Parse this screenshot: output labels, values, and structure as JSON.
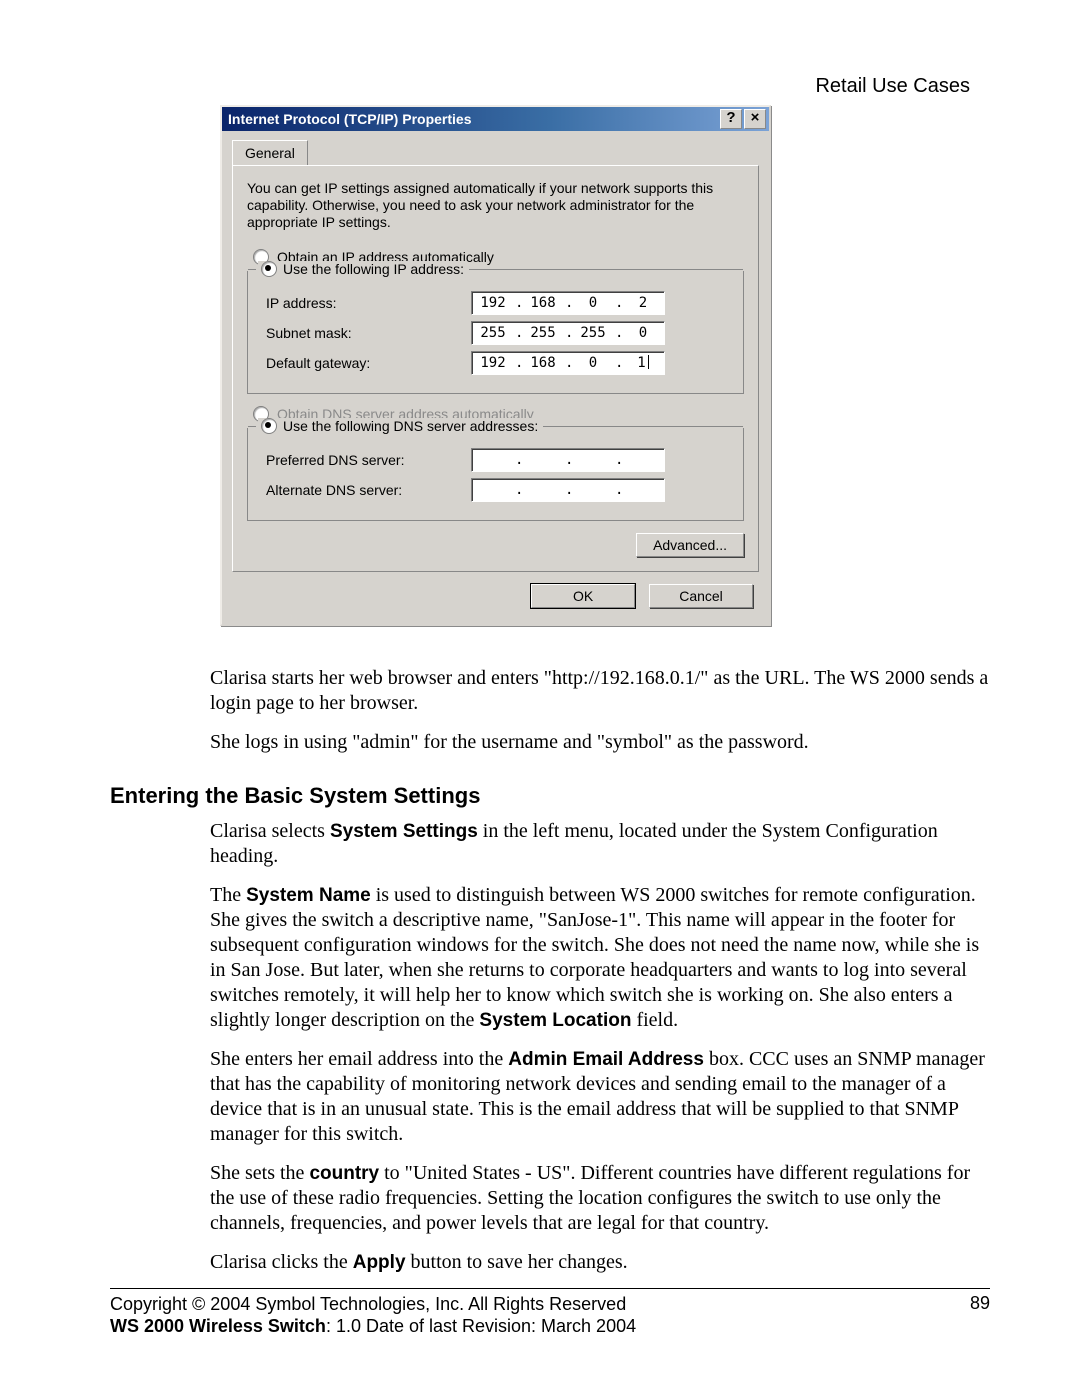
{
  "header": {
    "running": "Retail Use Cases"
  },
  "dialog": {
    "title": "Internet Protocol (TCP/IP) Properties",
    "help_glyph": "?",
    "close_glyph": "×",
    "tab": "General",
    "description": "You can get IP settings assigned automatically if your network supports this capability. Otherwise, you need to ask your network administrator for the appropriate IP settings.",
    "ip": {
      "auto_label": "Obtain an IP address automatically",
      "manual_label": "Use the following IP address:",
      "fields": {
        "ip_label": "IP address:",
        "ip_value": [
          "192",
          "168",
          "0",
          "2"
        ],
        "mask_label": "Subnet mask:",
        "mask_value": [
          "255",
          "255",
          "255",
          "0"
        ],
        "gw_label": "Default gateway:",
        "gw_value": [
          "192",
          "168",
          "0",
          "1"
        ]
      }
    },
    "dns": {
      "auto_label": "Obtain DNS server address automatically",
      "manual_label": "Use the following DNS server addresses:",
      "pref_label": "Preferred DNS server:",
      "alt_label": "Alternate DNS server:"
    },
    "advanced_label": "Advanced...",
    "ok_label": "OK",
    "cancel_label": "Cancel"
  },
  "body": {
    "p1a": "Clarisa starts her web browser and enters \"http://192.168.0.1/\" as the URL. The WS 2000 sends a login page to her browser.",
    "p1b": "She logs in using \"admin\" for the username and \"symbol\" as the password.",
    "h3": "Entering the Basic System Settings",
    "p2_pre": "Clarisa selects ",
    "p2_b": "System Settings",
    "p2_post": " in the left menu, located under the System Configuration heading.",
    "p3_pre": "The ",
    "p3_b": "System Name",
    "p3_mid": " is used to distinguish between WS 2000 switches for remote configuration. She gives the switch a descriptive name, \"SanJose-1\". This name will appear in the footer for subsequent configuration windows for the switch. She does not need the name now, while she is in San Jose. But later, when she returns to corporate headquarters and wants to log into several switches remotely, it will help her to know which switch she is working on. She also enters a slightly longer description on the ",
    "p3_b2": "System Location",
    "p3_post": " field.",
    "p4_pre": "She enters her email address into the ",
    "p4_b": "Admin Email Address",
    "p4_post": " box. CCC uses an SNMP manager that has the capability of monitoring network devices and sending email to the manager of a device that is in an unusual state. This is the email address that will be supplied to that SNMP manager for this switch.",
    "p5_pre": "She sets the ",
    "p5_b": "country",
    "p5_post": " to \"United States - US\". Different countries have different regulations for the use of these radio frequencies. Setting the location configures the switch to use only the channels, frequencies, and power levels that are legal for that country.",
    "p6_pre": "Clarisa clicks the ",
    "p6_b": "Apply",
    "p6_post": " button to save her changes."
  },
  "footer": {
    "copyright": "Copyright © 2004 Symbol Technologies, Inc. All Rights Reserved",
    "product_b": "WS 2000 Wireless Switch",
    "product_rest": ": 1.0  Date of last Revision: March 2004",
    "page": "89"
  }
}
